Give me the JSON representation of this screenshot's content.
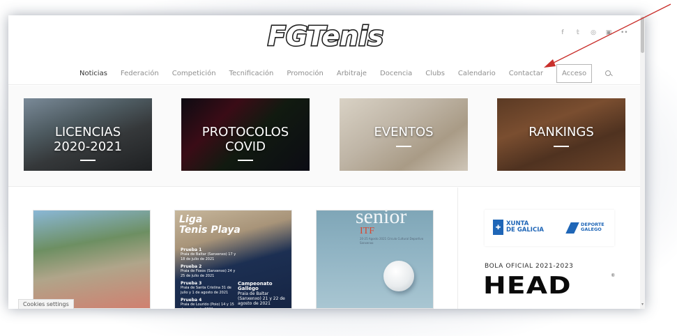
{
  "site": {
    "logo_text": "FGTenis",
    "social_icons": [
      "facebook-icon",
      "twitter-icon",
      "instagram-icon",
      "youtube-icon",
      "flickr-icon"
    ]
  },
  "nav": {
    "items": [
      "Noticias",
      "Federación",
      "Competición",
      "Tecnificación",
      "Promoción",
      "Arbitraje",
      "Docencia",
      "Clubs",
      "Calendario",
      "Contactar"
    ],
    "active": "Noticias",
    "acceso_label": "Acceso"
  },
  "banners": [
    {
      "line1": "LICENCIAS",
      "line2": "2020-2021"
    },
    {
      "line1": "PROTOCOLOS",
      "line2": "COVID"
    },
    {
      "line1": "EVENTOS",
      "line2": ""
    },
    {
      "line1": "RANKINGS",
      "line2": ""
    }
  ],
  "posts": {
    "p2": {
      "title_line1": "Liga",
      "title_line2": "Tenis Playa",
      "pruebas": [
        {
          "name": "Prueba 1",
          "detail": "Praia de Baltar (Sanxenxo) 17 y 18 de julio de 2021"
        },
        {
          "name": "Prueba 2",
          "detail": "Praia de Foxos (Sanxenxo) 24 y 25 de julio de 2021"
        },
        {
          "name": "Prueba 3",
          "detail": "Praia de Santa Cristina 31 de julio y 1 de agosto de 2021"
        },
        {
          "name": "Prueba 4",
          "detail": "Praia de Lourido (Poio) 14 y 15 de agosto de 2021"
        }
      ],
      "championship": "Campeonato Gallego",
      "championship_detail": "Praia de Baltar (Sanxenxo) 21 y 22 de agosto de 2021"
    },
    "p3": {
      "word": "senior",
      "itf": "ITF",
      "sub": "20-25 Agosto 2021 Círculo Cultural Deportivo Sanxenxo"
    }
  },
  "cookies_label": "Cookies settings",
  "sidebar": {
    "xunta_line1": "XUNTA",
    "xunta_line2": "DE GALICIA",
    "deporte_line1": "DEPORTE",
    "deporte_line2": "GALEGO",
    "bola_label": "BOLA OFICIAL 2021-2023",
    "head_label": "HEAD",
    "reg_mark": "®"
  },
  "colors": {
    "annotation_arrow": "#c9302c",
    "brand_blue": "#1f66b7"
  }
}
